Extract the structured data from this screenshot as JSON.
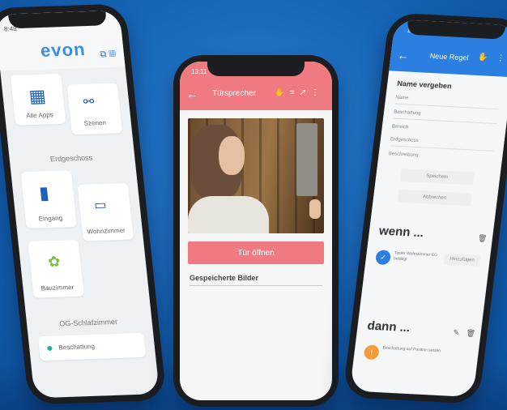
{
  "left_phone": {
    "status": "8:48",
    "logo": "evon",
    "tiles": [
      {
        "label": "Alle Apps",
        "icon": "grid-icon"
      },
      {
        "label": "Szenen",
        "icon": "scene-icon"
      },
      {
        "label": "Eingang",
        "icon": "door-icon"
      },
      {
        "label": "Wohnzimmer",
        "icon": "sofa-icon"
      },
      {
        "label": "Bauzimmer",
        "icon": "plant-icon"
      }
    ],
    "section_ground": "Erdgeschoss",
    "section_og": "OG-Schlafzimmer",
    "room_item": "Beschattung"
  },
  "middle_phone": {
    "time": "13:11",
    "title": "Türsprecher",
    "open_button": "Tür öffnen",
    "saved_images_label": "Gespeicherte Bilder"
  },
  "right_phone": {
    "time": "13:11",
    "title": "Neue Regel",
    "name_heading": "Name vergeben",
    "rows": [
      "Name",
      "Beschattung",
      "Bereich",
      "Erdgeschoss",
      "Beschreibung"
    ],
    "btn_speichern": "Speichern",
    "btn_abbrechen": "Abbrechen",
    "wenn_label": "wenn ...",
    "wenn_text": "Taster Wohnzimmer EG betätigt",
    "wenn_btn": "Hinzufügen",
    "dann_label": "dann ...",
    "dann_text": "Beschattung auf Position setzen"
  },
  "colors": {
    "background": "#1565b6",
    "pink": "#f07a82",
    "blue": "#2a7fe0"
  }
}
